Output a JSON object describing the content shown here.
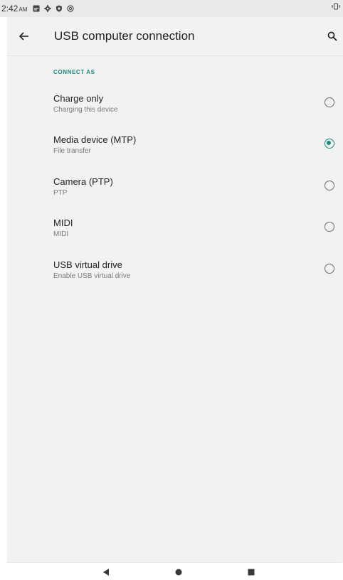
{
  "status_bar": {
    "time": "2:42",
    "ampm": "AM",
    "icons": [
      "image-icon",
      "gear-icon",
      "shield-icon",
      "data-saver-icon"
    ],
    "right_icons": [
      "vibrate-icon"
    ]
  },
  "app_bar": {
    "title": "USB computer connection",
    "back_icon": "arrow-left-icon",
    "search_icon": "search-icon"
  },
  "section": {
    "header": "CONNECT AS"
  },
  "options": [
    {
      "label": "Charge only",
      "sub": "Charging this device",
      "checked": false
    },
    {
      "label": "Media device (MTP)",
      "sub": "File transfer",
      "checked": true
    },
    {
      "label": "Camera (PTP)",
      "sub": "PTP",
      "checked": false
    },
    {
      "label": "MIDI",
      "sub": "MIDI",
      "checked": false
    },
    {
      "label": "USB virtual drive",
      "sub": "Enable USB virtual drive",
      "checked": false
    }
  ],
  "nav_bar": {
    "icons": [
      "nav-back-icon",
      "nav-home-icon",
      "nav-recents-icon"
    ]
  },
  "colors": {
    "accent": "#1a8a7a",
    "background": "#f2f2f2",
    "status_bar": "#e9e9e9"
  }
}
